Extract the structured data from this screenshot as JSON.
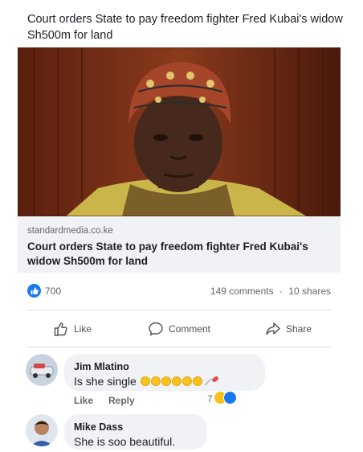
{
  "post": {
    "text": "Court orders State to pay freedom fighter Fred Kubai's widow Sh500m for land"
  },
  "link_card": {
    "domain": "standardmedia.co.ke",
    "title": "Court orders State to pay freedom fighter Fred Kubai's widow Sh500m for land"
  },
  "stats": {
    "reactions": "700",
    "comments": "149 comments",
    "separator": "·",
    "shares": "10 shares"
  },
  "actions": {
    "like": "Like",
    "comment": "Comment",
    "share": "Share"
  },
  "comments": [
    {
      "author": "Jim Mlatino",
      "text": "Is she single",
      "like_label": "Like",
      "reply_label": "Reply",
      "reaction_count": "7"
    },
    {
      "author": "Mike Dass",
      "text": "She is soo beautiful."
    }
  ],
  "colors": {
    "facebook_blue": "#1877f2",
    "bubble_grey": "#f0f2f5",
    "meta_grey": "#65676b"
  }
}
